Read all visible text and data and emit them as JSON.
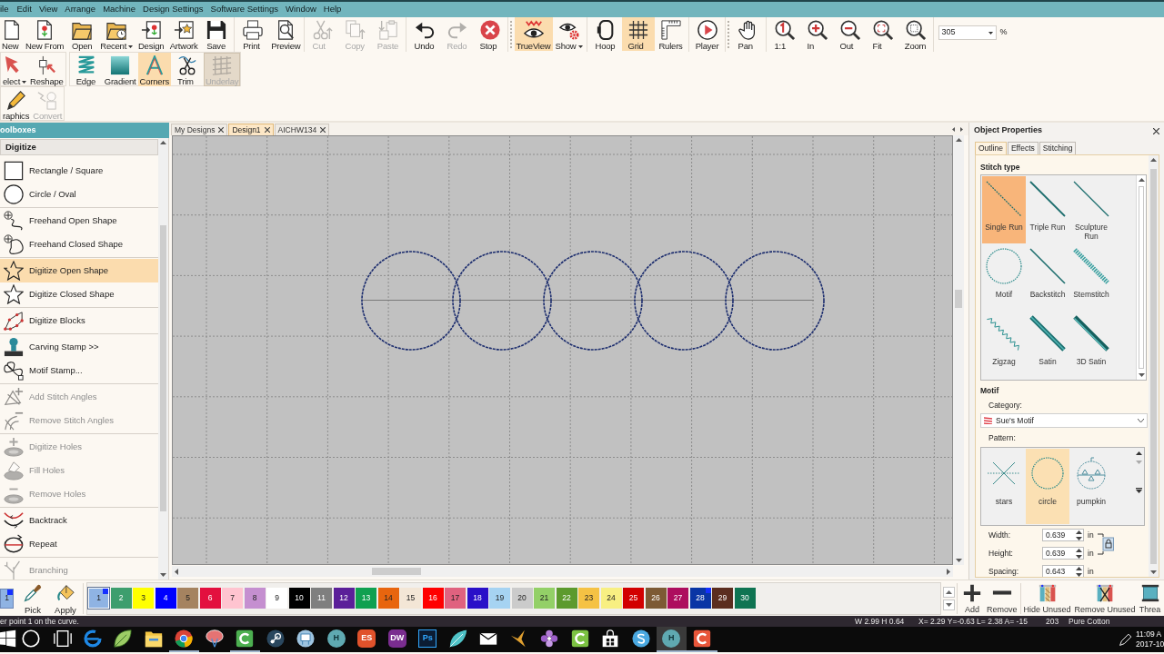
{
  "menu_bar": [
    "ile",
    "Edit",
    "View",
    "Arrange",
    "Machine",
    "Design Settings",
    "Software Settings",
    "Window",
    "Help"
  ],
  "toolbar": {
    "rows": [
      {
        "groups": [
          {
            "buttons": [
              {
                "label": "New",
                "selected": false,
                "disabled": false,
                "dropdown": false
              },
              {
                "label": "New From",
                "selected": false,
                "disabled": false,
                "dropdown": false
              },
              {
                "label": "Open",
                "selected": false,
                "disabled": false,
                "dropdown": false
              },
              {
                "label": "Recent",
                "selected": false,
                "disabled": false,
                "dropdown": true
              },
              {
                "label": "Design",
                "selected": false,
                "disabled": false,
                "dropdown": false
              },
              {
                "label": "Artwork",
                "selected": false,
                "disabled": false,
                "dropdown": false
              },
              {
                "label": "Save",
                "selected": false,
                "disabled": false,
                "dropdown": false
              }
            ]
          },
          {
            "buttons": [
              {
                "label": "Print",
                "selected": false,
                "disabled": false,
                "dropdown": false
              },
              {
                "label": "Preview",
                "selected": false,
                "disabled": false,
                "dropdown": false
              }
            ]
          },
          {
            "buttons": [
              {
                "label": "Cut",
                "selected": false,
                "disabled": true,
                "dropdown": false
              },
              {
                "label": "Copy",
                "selected": false,
                "disabled": true,
                "dropdown": false
              },
              {
                "label": "Paste",
                "selected": false,
                "disabled": true,
                "dropdown": false
              }
            ]
          },
          {
            "buttons": [
              {
                "label": "Undo",
                "selected": false,
                "disabled": false,
                "dropdown": false
              },
              {
                "label": "Redo",
                "selected": false,
                "disabled": true,
                "dropdown": false
              },
              {
                "label": "Stop",
                "selected": false,
                "disabled": false,
                "dropdown": false
              }
            ]
          },
          {
            "buttons": [
              {
                "label": "TrueView",
                "selected": true,
                "disabled": false,
                "dropdown": false
              },
              {
                "label": "Show",
                "selected": false,
                "disabled": false,
                "dropdown": true
              }
            ]
          },
          {
            "buttons": [
              {
                "label": "Hoop",
                "selected": false,
                "disabled": false,
                "dropdown": false
              },
              {
                "label": "Grid",
                "selected": true,
                "disabled": false,
                "dropdown": false
              },
              {
                "label": "Rulers",
                "selected": false,
                "disabled": false,
                "dropdown": false
              }
            ]
          },
          {
            "buttons": [
              {
                "label": "Player",
                "selected": false,
                "disabled": false,
                "dropdown": false
              }
            ]
          },
          {
            "buttons": [
              {
                "label": "Pan",
                "selected": false,
                "disabled": false,
                "dropdown": false
              }
            ]
          },
          {
            "buttons": [
              {
                "label": "1:1",
                "selected": false,
                "disabled": false,
                "dropdown": false
              },
              {
                "label": "In",
                "selected": false,
                "disabled": false,
                "dropdown": false
              },
              {
                "label": "Out",
                "selected": false,
                "disabled": false,
                "dropdown": false
              },
              {
                "label": "Fit",
                "selected": false,
                "disabled": false,
                "dropdown": false
              },
              {
                "label": "Zoom",
                "selected": false,
                "disabled": false,
                "dropdown": false
              }
            ]
          }
        ]
      },
      {
        "groups": [
          {
            "buttons": [
              {
                "label": "elect",
                "selected": false,
                "disabled": false,
                "dropdown": true
              },
              {
                "label": "Reshape",
                "selected": false,
                "disabled": false,
                "dropdown": false
              }
            ]
          },
          {
            "buttons": [
              {
                "label": "Edge",
                "selected": false,
                "disabled": false,
                "dropdown": false
              },
              {
                "label": "Gradient",
                "selected": false,
                "disabled": false,
                "dropdown": false
              },
              {
                "label": "Corners",
                "selected": true,
                "disabled": false,
                "dropdown": false
              },
              {
                "label": "Trim",
                "selected": false,
                "disabled": false,
                "dropdown": false
              },
              {
                "label": "Underlay",
                "selected": true,
                "disabled": true,
                "dropdown": false
              }
            ]
          }
        ]
      },
      {
        "groups": [
          {
            "buttons": [
              {
                "label": "raphics",
                "selected": false,
                "disabled": false,
                "dropdown": false
              },
              {
                "label": "Convert",
                "selected": false,
                "disabled": true,
                "dropdown": false
              }
            ]
          }
        ]
      }
    ],
    "zoom_box": {
      "value": "305",
      "unit": "%"
    }
  },
  "toolbox": {
    "title": "oolboxes",
    "section": "Digitize",
    "groups": [
      {
        "items": [
          {
            "label": "Rectangle / Square",
            "selected": false,
            "disabled": false
          },
          {
            "label": "Circle / Oval",
            "selected": false,
            "disabled": false
          }
        ]
      },
      {
        "items": [
          {
            "label": "Freehand Open Shape",
            "selected": false,
            "disabled": false
          },
          {
            "label": "Freehand Closed Shape",
            "selected": false,
            "disabled": false
          }
        ]
      },
      {
        "items": [
          {
            "label": "Digitize Open Shape",
            "selected": true,
            "disabled": false
          },
          {
            "label": "Digitize Closed Shape",
            "selected": false,
            "disabled": false
          }
        ]
      },
      {
        "items": [
          {
            "label": "Digitize Blocks",
            "selected": false,
            "disabled": false
          }
        ]
      },
      {
        "items": [
          {
            "label": "Carving Stamp >>",
            "selected": false,
            "disabled": false
          },
          {
            "label": "Motif Stamp...",
            "selected": false,
            "disabled": false
          }
        ]
      },
      {
        "items": [
          {
            "label": "Add Stitch Angles",
            "selected": false,
            "disabled": true
          },
          {
            "label": "Remove Stitch Angles",
            "selected": false,
            "disabled": true
          }
        ]
      },
      {
        "items": [
          {
            "label": "Digitize Holes",
            "selected": false,
            "disabled": true
          },
          {
            "label": "Fill Holes",
            "selected": false,
            "disabled": true
          },
          {
            "label": "Remove Holes",
            "selected": false,
            "disabled": true
          }
        ]
      },
      {
        "items": [
          {
            "label": "Backtrack",
            "selected": false,
            "disabled": false
          },
          {
            "label": "Repeat",
            "selected": false,
            "disabled": false
          }
        ]
      },
      {
        "items": [
          {
            "label": "Branching",
            "selected": false,
            "disabled": true
          }
        ]
      }
    ]
  },
  "document_tabs": [
    {
      "label": "My Designs",
      "selected": false
    },
    {
      "label": "Design1",
      "selected": true
    },
    {
      "label": "AICHW134",
      "selected": false
    }
  ],
  "object_properties": {
    "title": "Object Properties",
    "tabs": [
      {
        "label": "Outline",
        "selected": true
      },
      {
        "label": "Effects",
        "selected": false
      },
      {
        "label": "Stitching",
        "selected": false
      }
    ],
    "stitch_type": {
      "heading": "Stitch type",
      "options": [
        {
          "label": "Single Run",
          "selected": true
        },
        {
          "label": "Triple Run",
          "selected": false
        },
        {
          "label": "Sculpture Run",
          "selected": false
        },
        {
          "label": "Motif",
          "selected": false
        },
        {
          "label": "Backstitch",
          "selected": false
        },
        {
          "label": "Stemstitch",
          "selected": false
        },
        {
          "label": "Zigzag",
          "selected": false
        },
        {
          "label": "Satin",
          "selected": false
        },
        {
          "label": "3D Satin",
          "selected": false
        }
      ]
    },
    "motif": {
      "heading": "Motif",
      "category_label": "Category:",
      "category": "Sue's Motif",
      "pattern_label": "Pattern:",
      "patterns": [
        {
          "label": "stars",
          "selected": false
        },
        {
          "label": "circle",
          "selected": true
        },
        {
          "label": "pumpkin",
          "selected": false
        }
      ]
    },
    "fields": [
      {
        "label": "Width:",
        "value": "0.639",
        "unit": "in"
      },
      {
        "label": "Height:",
        "value": "0.639",
        "unit": "in"
      },
      {
        "label": "Spacing:",
        "value": "0.643",
        "unit": "in"
      }
    ]
  },
  "color_bar": {
    "current": {
      "label": "1",
      "color": "#8fb3e3",
      "corner_mark": true
    },
    "tools": [
      "Pick",
      "Apply"
    ],
    "swatches": [
      {
        "label": "1",
        "color": "#8fb3e3",
        "selected": true,
        "corner_mark": true
      },
      {
        "label": "2",
        "color": "#3d9e6e",
        "selected": false,
        "corner_mark": false
      },
      {
        "label": "3",
        "color": "#ffff00",
        "selected": false,
        "corner_mark": false
      },
      {
        "label": "4",
        "color": "#0000ff",
        "selected": false,
        "corner_mark": false
      },
      {
        "label": "5",
        "color": "#a58360",
        "selected": false,
        "corner_mark": false
      },
      {
        "label": "6",
        "color": "#e3103f",
        "selected": false,
        "corner_mark": false
      },
      {
        "label": "7",
        "color": "#ffc4d0",
        "selected": false,
        "corner_mark": false
      },
      {
        "label": "8",
        "color": "#c58fd0",
        "selected": false,
        "corner_mark": false
      },
      {
        "label": "9",
        "color": "#ffffff",
        "selected": false,
        "corner_mark": false
      },
      {
        "label": "10",
        "color": "#000000",
        "selected": false,
        "corner_mark": false
      },
      {
        "label": "11",
        "color": "#7f7f7f",
        "selected": false,
        "corner_mark": false
      },
      {
        "label": "12",
        "color": "#5b1f99",
        "selected": false,
        "corner_mark": false
      },
      {
        "label": "13",
        "color": "#10a050",
        "selected": false,
        "corner_mark": false
      },
      {
        "label": "14",
        "color": "#e8650e",
        "selected": false,
        "corner_mark": false
      },
      {
        "label": "15",
        "color": "#f3e6d6",
        "selected": false,
        "corner_mark": false
      },
      {
        "label": "16",
        "color": "#ff0000",
        "selected": false,
        "corner_mark": false
      },
      {
        "label": "17",
        "color": "#e0627f",
        "selected": false,
        "corner_mark": false
      },
      {
        "label": "18",
        "color": "#2a10c8",
        "selected": false,
        "corner_mark": false
      },
      {
        "label": "19",
        "color": "#a6d3f2",
        "selected": false,
        "corner_mark": false
      },
      {
        "label": "20",
        "color": "#cbcbcb",
        "selected": false,
        "corner_mark": false
      },
      {
        "label": "21",
        "color": "#93d067",
        "selected": false,
        "corner_mark": false
      },
      {
        "label": "22",
        "color": "#5c9a2d",
        "selected": false,
        "corner_mark": false
      },
      {
        "label": "23",
        "color": "#f5c244",
        "selected": false,
        "corner_mark": false
      },
      {
        "label": "24",
        "color": "#f8ef82",
        "selected": false,
        "corner_mark": false
      },
      {
        "label": "25",
        "color": "#d20000",
        "selected": false,
        "corner_mark": false
      },
      {
        "label": "26",
        "color": "#7d5a34",
        "selected": false,
        "corner_mark": false
      },
      {
        "label": "27",
        "color": "#ad0d5e",
        "selected": false,
        "corner_mark": false
      },
      {
        "label": "28",
        "color": "#0a35a5",
        "selected": false,
        "corner_mark": true
      },
      {
        "label": "29",
        "color": "#5b2d1f",
        "selected": false,
        "corner_mark": false
      },
      {
        "label": "30",
        "color": "#0f7452",
        "selected": false,
        "corner_mark": false
      }
    ],
    "actions": [
      "Add",
      "Remove",
      "Hide Unused",
      "Remove Unused",
      "Threa"
    ]
  },
  "status_bar": {
    "message": "er point 1 on the curve.",
    "dimensions": "W 2.99 H 0.64",
    "coordinates": "X= 2.29 Y=-0.63 L= 2.38 A= -15",
    "count": "203",
    "thread": "Pure Cotton"
  },
  "taskbar": {
    "buttons": [
      {
        "kind": "icon",
        "running": false,
        "selected": false
      },
      {
        "kind": "icon",
        "running": false,
        "selected": false
      },
      {
        "kind": "icon",
        "running": false,
        "selected": false
      },
      {
        "kind": "icon",
        "running": false,
        "selected": false
      },
      {
        "kind": "icon",
        "running": false,
        "selected": false
      },
      {
        "kind": "icon",
        "running": false,
        "selected": false
      },
      {
        "kind": "icon",
        "running": true,
        "selected": false
      },
      {
        "kind": "icon",
        "running": false,
        "selected": false
      },
      {
        "kind": "icon",
        "running": true,
        "selected": false
      },
      {
        "kind": "icon",
        "running": false,
        "selected": false
      },
      {
        "kind": "icon",
        "running": false,
        "selected": false
      },
      {
        "kind": "letter",
        "label": "H",
        "running": false,
        "selected": false
      },
      {
        "kind": "letter",
        "label": "ES",
        "running": false,
        "selected": false
      },
      {
        "kind": "letter",
        "label": "DW",
        "running": false,
        "selected": false
      },
      {
        "kind": "letter",
        "label": "Ps",
        "running": false,
        "selected": false
      },
      {
        "kind": "icon",
        "running": false,
        "selected": false
      },
      {
        "kind": "icon",
        "running": false,
        "selected": false
      },
      {
        "kind": "icon",
        "running": false,
        "selected": false
      },
      {
        "kind": "icon",
        "running": false,
        "selected": false
      },
      {
        "kind": "icon",
        "running": false,
        "selected": false
      },
      {
        "kind": "icon",
        "running": false,
        "selected": false
      },
      {
        "kind": "icon",
        "running": false,
        "selected": false
      },
      {
        "kind": "letter",
        "label": "H",
        "running": true,
        "selected": true
      },
      {
        "kind": "icon",
        "running": true,
        "selected": false
      }
    ],
    "clock": {
      "time": "11:09 A",
      "date": "2017-10"
    }
  }
}
